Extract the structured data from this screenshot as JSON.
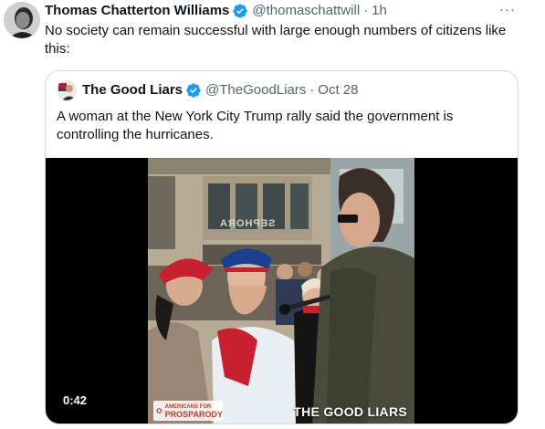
{
  "tweet": {
    "author_name": "Thomas Chatterton Williams",
    "handle": "@thomaschattwill",
    "time": "1h",
    "separator": "·",
    "more_label": "···",
    "text": "No society can remain successful with large enough numbers of citizens like this:"
  },
  "quote": {
    "author_name": "The Good Liars",
    "handle": "@TheGoodLiars",
    "date": "Oct 28",
    "separator": "·",
    "text": "A woman at the New York City Trump rally said the government is controlling the hurricanes."
  },
  "media": {
    "duration": "0:42",
    "watermark": "THE GOOD LIARS",
    "logo_small": "AMERICANS FOR",
    "logo_big": "PROSPARODY",
    "store_sign": "SEPHORA"
  },
  "colors": {
    "verified": "#1d9bf0",
    "text": "#0f1419",
    "muted": "#536471",
    "border": "#cfd9de"
  },
  "icons": {
    "verified": "verified-badge-icon",
    "more": "more-icon"
  }
}
